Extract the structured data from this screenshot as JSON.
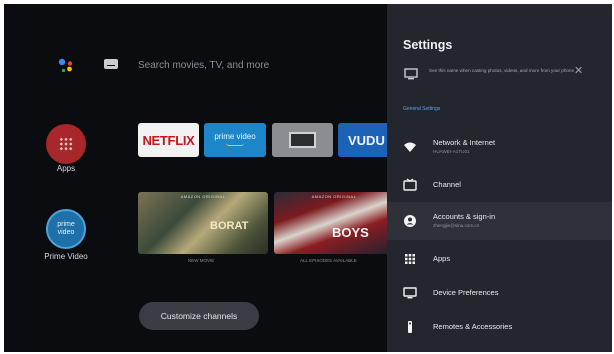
{
  "home": {
    "search_placeholder": "Search movies, TV, and more",
    "apps_label": "Apps",
    "prime_circle_text": "prime video",
    "prime_label": "Prime Video",
    "customize_label": "Customize channels",
    "app_cards": {
      "netflix": "NETFLIX",
      "prime": "prime video",
      "vudu": "VUDU"
    },
    "posters": [
      {
        "band": "AMAZON ORIGINAL",
        "title": "BORAT",
        "caption": "NEW MOVIE"
      },
      {
        "band": "AMAZON ORIGINAL",
        "title": "BOYS",
        "caption": "ALL EPISODES AVAILABLE"
      }
    ]
  },
  "settings": {
    "title": "Settings",
    "info_text": "See this name when casting photos, videos, and more from your phone",
    "section_label": "General Settings",
    "items": [
      {
        "label": "Network & Internet",
        "sub": "HUAWEI-A1TU01",
        "icon": "wifi-icon"
      },
      {
        "label": "Channel",
        "sub": "",
        "icon": "tv-icon"
      },
      {
        "label": "Accounts & sign-in",
        "sub": "zhengjie@sina.com.cn",
        "icon": "account-icon"
      },
      {
        "label": "Apps",
        "sub": "",
        "icon": "apps-grid-icon"
      },
      {
        "label": "Device Preferences",
        "sub": "",
        "icon": "monitor-icon"
      },
      {
        "label": "Remotes & Accessories",
        "sub": "",
        "icon": "remote-icon"
      }
    ]
  },
  "colors": {
    "background": "#0b0c0f",
    "panel": "#23262c",
    "accent_blue": "#5fa3e6",
    "apps_red": "#a8272a",
    "netflix_red": "#c5161d"
  }
}
